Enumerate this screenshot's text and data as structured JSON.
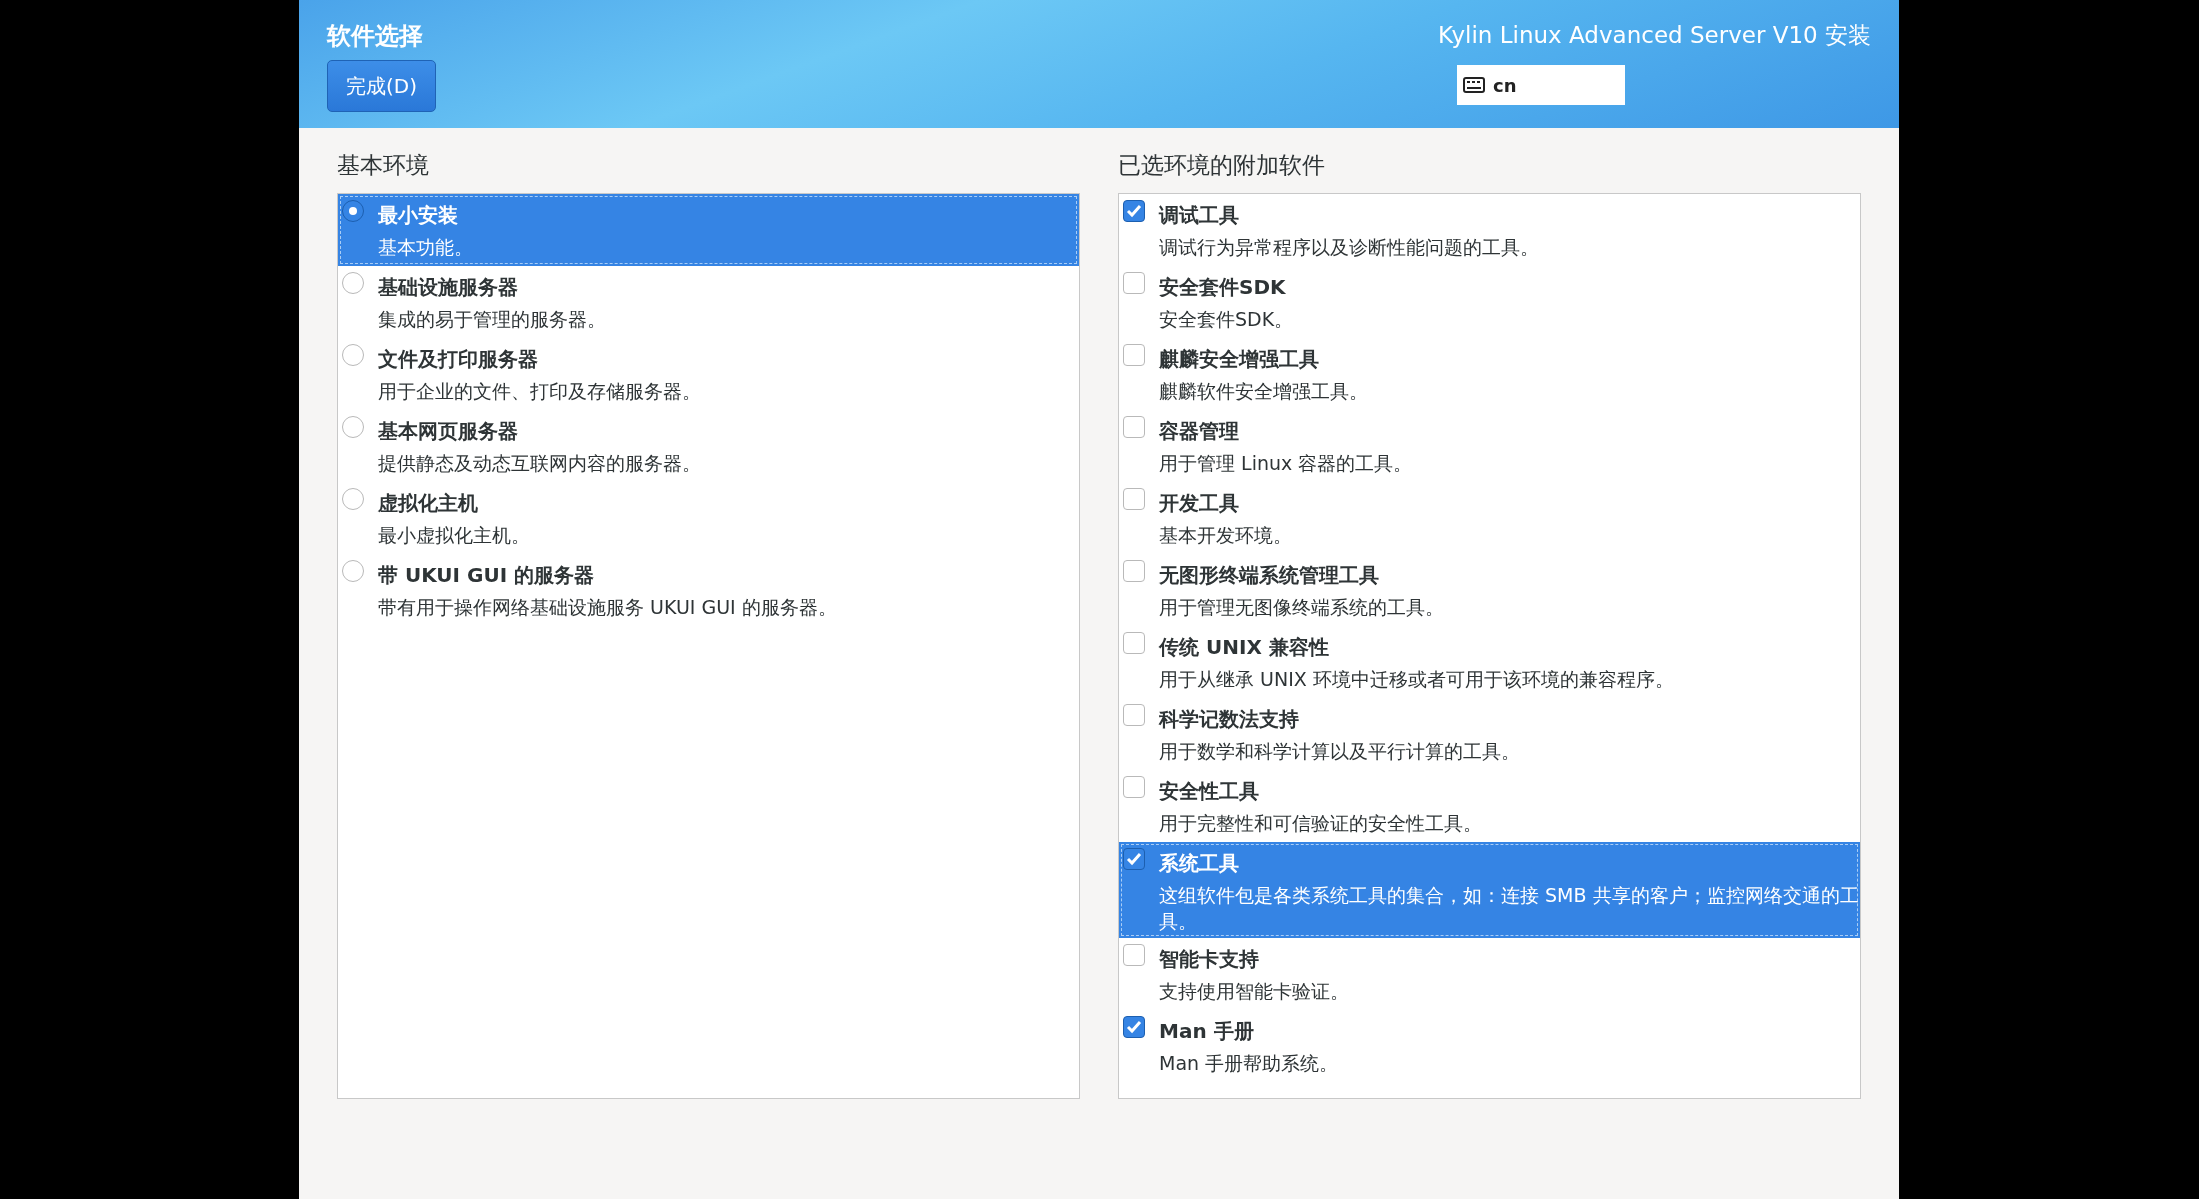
{
  "header": {
    "title": "软件选择",
    "done_button": "完成(D)",
    "product": "Kylin Linux Advanced Server V10 安装",
    "keyboard_layout": "cn"
  },
  "base_environment": {
    "heading": "基本环境",
    "items": [
      {
        "name": "最小安装",
        "description": "基本功能。",
        "selected": true
      },
      {
        "name": "基础设施服务器",
        "description": "集成的易于管理的服务器。",
        "selected": false
      },
      {
        "name": "文件及打印服务器",
        "description": "用于企业的文件、打印及存储服务器。",
        "selected": false
      },
      {
        "name": "基本网页服务器",
        "description": "提供静态及动态互联网内容的服务器。",
        "selected": false
      },
      {
        "name": "虚拟化主机",
        "description": "最小虚拟化主机。",
        "selected": false
      },
      {
        "name": "带 UKUI GUI 的服务器",
        "description": "带有用于操作网络基础设施服务 UKUI GUI 的服务器。",
        "selected": false
      }
    ]
  },
  "addons": {
    "heading": "已选环境的附加软件",
    "items": [
      {
        "name": "调试工具",
        "description": "调试行为异常程序以及诊断性能问题的工具。",
        "checked": true,
        "selected": false
      },
      {
        "name": "安全套件SDK",
        "description": "安全套件SDK。",
        "checked": false,
        "selected": false
      },
      {
        "name": "麒麟安全增强工具",
        "description": "麒麟软件安全增强工具。",
        "checked": false,
        "selected": false
      },
      {
        "name": "容器管理",
        "description": "用于管理 Linux 容器的工具。",
        "checked": false,
        "selected": false
      },
      {
        "name": "开发工具",
        "description": "基本开发环境。",
        "checked": false,
        "selected": false
      },
      {
        "name": "无图形终端系统管理工具",
        "description": "用于管理无图像终端系统的工具。",
        "checked": false,
        "selected": false
      },
      {
        "name": "传统 UNIX 兼容性",
        "description": "用于从继承 UNIX 环境中迁移或者可用于该环境的兼容程序。",
        "checked": false,
        "selected": false
      },
      {
        "name": "科学记数法支持",
        "description": "用于数学和科学计算以及平行计算的工具。",
        "checked": false,
        "selected": false
      },
      {
        "name": "安全性工具",
        "description": "用于完整性和可信验证的安全性工具。",
        "checked": false,
        "selected": false
      },
      {
        "name": "系统工具",
        "description": "这组软件包是各类系统工具的集合，如：连接 SMB 共享的客户；监控网络交通的工具。",
        "checked": true,
        "selected": true
      },
      {
        "name": "智能卡支持",
        "description": "支持使用智能卡验证。",
        "checked": false,
        "selected": false
      },
      {
        "name": "Man 手册",
        "description": "Man 手册帮助系统。",
        "checked": true,
        "selected": false
      }
    ]
  }
}
